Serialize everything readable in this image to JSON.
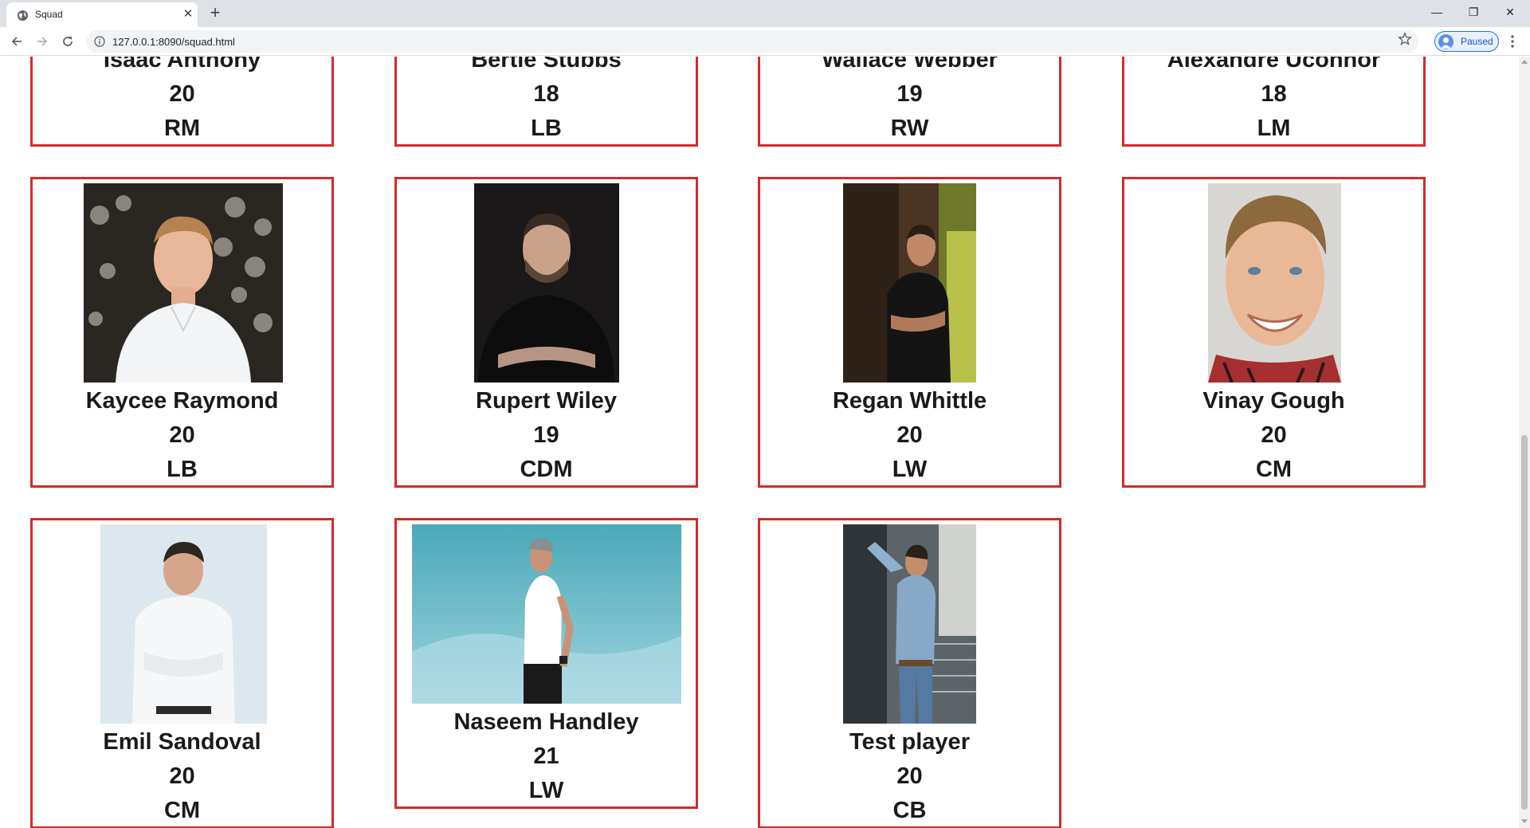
{
  "browser": {
    "tab_title": "Squad",
    "url": "127.0.0.1:8090/squad.html",
    "profile_label": "Paused"
  },
  "players": [
    {
      "name": "Isaac Anthony",
      "age": "20",
      "position": "RM"
    },
    {
      "name": "Bertie Stubbs",
      "age": "18",
      "position": "LB"
    },
    {
      "name": "Wallace Webber",
      "age": "19",
      "position": "RW"
    },
    {
      "name": "Alexandre Uconnor",
      "age": "18",
      "position": "LM"
    },
    {
      "name": "Kaycee Raymond",
      "age": "20",
      "position": "LB"
    },
    {
      "name": "Rupert Wiley",
      "age": "19",
      "position": "CDM"
    },
    {
      "name": "Regan Whittle",
      "age": "20",
      "position": "LW"
    },
    {
      "name": "Vinay Gough",
      "age": "20",
      "position": "CM"
    },
    {
      "name": "Emil Sandoval",
      "age": "20",
      "position": "CM"
    },
    {
      "name": "Naseem Handley",
      "age": "21",
      "position": "LW"
    },
    {
      "name": "Test player",
      "age": "20",
      "position": "CB"
    }
  ],
  "colors": {
    "card_border": "#d22b2b",
    "text": "#1a1a1a"
  }
}
